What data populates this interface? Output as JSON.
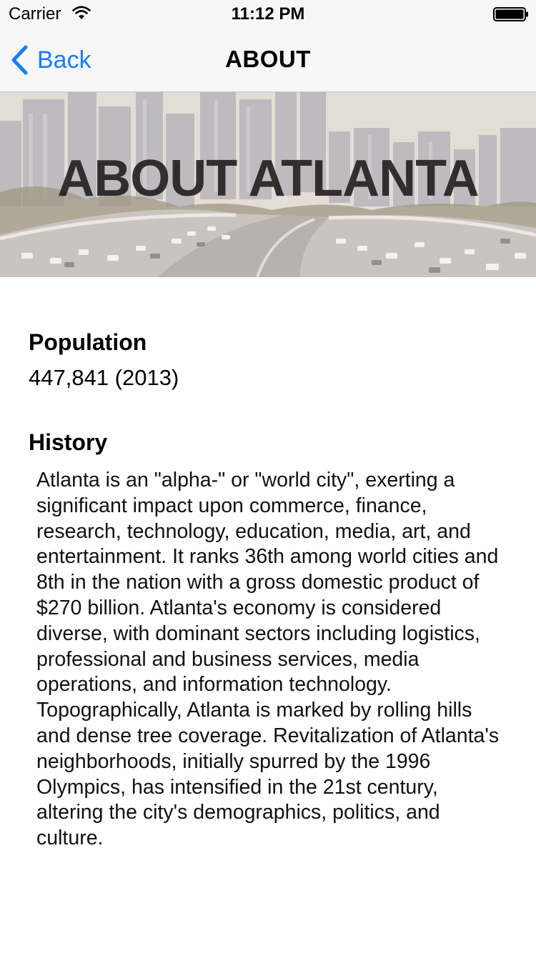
{
  "status_bar": {
    "carrier": "Carrier",
    "time": "11:12 PM"
  },
  "nav": {
    "back_label": "Back",
    "title": "ABOUT",
    "accent_color": "#157efb"
  },
  "hero": {
    "title": "ABOUT ATLANTA"
  },
  "population": {
    "heading": "Population",
    "value": "447,841 (2013)"
  },
  "history": {
    "heading": "History",
    "body": "Atlanta is an \"alpha-\" or \"world city\", exerting a significant impact upon commerce, finance, research, technology, education, media, art, and entertainment. It ranks 36th among world cities and 8th in the nation with a gross domestic product of $270 billion. Atlanta's economy is considered diverse, with dominant sectors including logistics, professional and business services, media operations, and information technology. Topographically, Atlanta is marked by rolling hills and dense tree coverage. Revitalization of Atlanta's neighborhoods, initially spurred by the 1996 Olympics, has intensified in the 21st century, altering the city's demographics, politics, and culture."
  }
}
